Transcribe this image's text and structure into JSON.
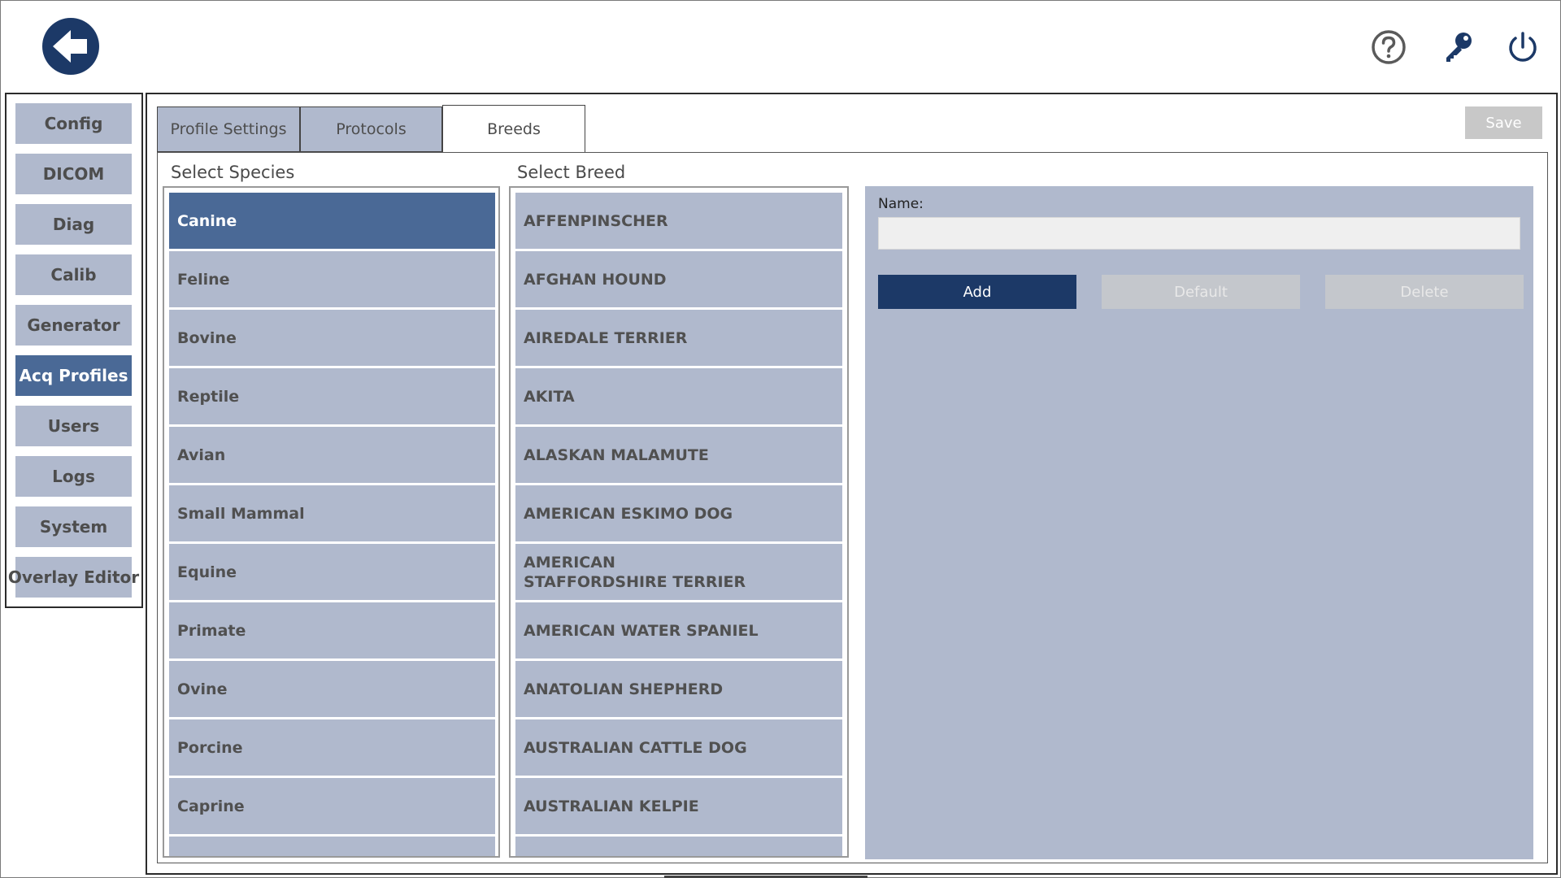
{
  "header": {
    "back_icon": "back-arrow-icon",
    "help_icon": "help-icon",
    "key_icon": "key-icon",
    "power_icon": "power-icon",
    "accent_color": "#1c3967"
  },
  "sidebar": {
    "items": [
      {
        "label": "Config"
      },
      {
        "label": "DICOM"
      },
      {
        "label": "Diag"
      },
      {
        "label": "Calib"
      },
      {
        "label": "Generator"
      },
      {
        "label": "Acq Profiles",
        "active": true
      },
      {
        "label": "Users"
      },
      {
        "label": "Logs"
      },
      {
        "label": "System"
      },
      {
        "label": "Overlay Editor"
      }
    ],
    "active_color": "#4a6996",
    "item_color": "#b0b9cd"
  },
  "tabs": [
    {
      "label": "Profile Settings"
    },
    {
      "label": "Protocols"
    },
    {
      "label": "Breeds",
      "active": true
    }
  ],
  "toolbar": {
    "save_label": "Save"
  },
  "species": {
    "title": "Select Species",
    "items": [
      "Canine",
      "Feline",
      "Bovine",
      "Reptile",
      "Avian",
      "Small Mammal",
      "Equine",
      "Primate",
      "Ovine",
      "Porcine",
      "Caprine"
    ],
    "selected": "Canine"
  },
  "breeds": {
    "title": "Select Breed",
    "items": [
      "AFFENPINSCHER",
      "AFGHAN HOUND",
      "AIREDALE TERRIER",
      "AKITA",
      "ALASKAN MALAMUTE",
      "AMERICAN ESKIMO DOG",
      "AMERICAN STAFFORDSHIRE TERRIER",
      "AMERICAN WATER SPANIEL",
      "ANATOLIAN SHEPHERD",
      "AUSTRALIAN CATTLE DOG",
      "AUSTRALIAN KELPIE"
    ]
  },
  "details": {
    "name_label": "Name:",
    "name_value": "",
    "add_label": "Add",
    "default_label": "Default",
    "delete_label": "Delete"
  }
}
